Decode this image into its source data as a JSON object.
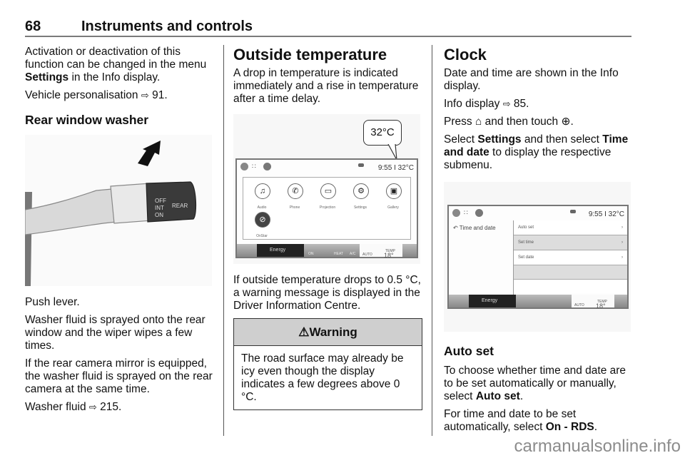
{
  "header": {
    "page_number": "68",
    "title": "Instruments and controls"
  },
  "left": {
    "intro_line1": "Activation or deactivation of this",
    "intro_line2": "function can be changed in the menu",
    "intro_bold": "Settings",
    "intro_rest": " in the Info display.",
    "ref_text": "Vehicle personalisation ",
    "ref_icon": "⇨",
    "ref_page": " 91.",
    "heading": "Rear window washer",
    "figure": {
      "lever_labels": [
        "OFF",
        "INT",
        "ON",
        "REAR"
      ]
    },
    "p1": "Push lever.",
    "p2": "Washer fluid is sprayed onto the rear window and the wiper wipes a few times.",
    "p3": "If the rear camera mirror is equipped, the washer fluid is sprayed on the rear camera at the same time.",
    "ref2_text": "Washer fluid ",
    "ref2_page": " 215."
  },
  "middle": {
    "heading": "Outside temperature",
    "p1": "A drop in temperature is indicated immediately and a rise in temperature after a time delay.",
    "figure": {
      "callout": "32°C",
      "status": "9:55 I 32°C",
      "apps": [
        "Audio",
        "Phone",
        "Projection",
        "Settings",
        "Gallery",
        "OnStar"
      ],
      "energy_label": "Energy",
      "climate_buttons": [
        "ON",
        "",
        "HEAT",
        "A/C"
      ],
      "auto_label": "AUTO",
      "temp_label": "TEMP",
      "temp_value": "18°"
    },
    "p2": "If outside temperature drops to 0.5 °C, a warning message is displayed in the Driver Information Centre.",
    "warning": {
      "icon": "⚠",
      "title": "Warning",
      "body": "The road surface may already be icy even though the display indicates a few degrees above 0 °C."
    }
  },
  "right": {
    "heading": "Clock",
    "p1": "Date and time are shown in the Info display.",
    "ref_text": "Info display ",
    "ref_page": " 85.",
    "press_a": "Press ",
    "home_icon": "⌂",
    "press_b": " and then touch ",
    "apps_icon": "⊕",
    "press_c": ".",
    "select_a": "Select ",
    "select_bold1": "Settings",
    "select_b": " and then select ",
    "select_bold2": "Time and date",
    "select_c": " to display the respective submenu.",
    "figure": {
      "status": "9:55 I 32°C",
      "back_title": "Time and date",
      "menu_items": [
        "Auto set",
        "Set time",
        "Set date",
        "",
        ""
      ],
      "energy_label": "Energy",
      "auto_label": "AUTO",
      "temp_label": "TEMP",
      "temp_value": "18°"
    },
    "subheading": "Auto set",
    "p2a": "To choose whether time and date are to be set automatically or manually, select ",
    "p2bold": "Auto set",
    "p2c": ".",
    "p3a": "For time and date to be set automatically, select ",
    "p3bold": "On - RDS",
    "p3c": "."
  },
  "watermark": "carmanualsonline.info"
}
